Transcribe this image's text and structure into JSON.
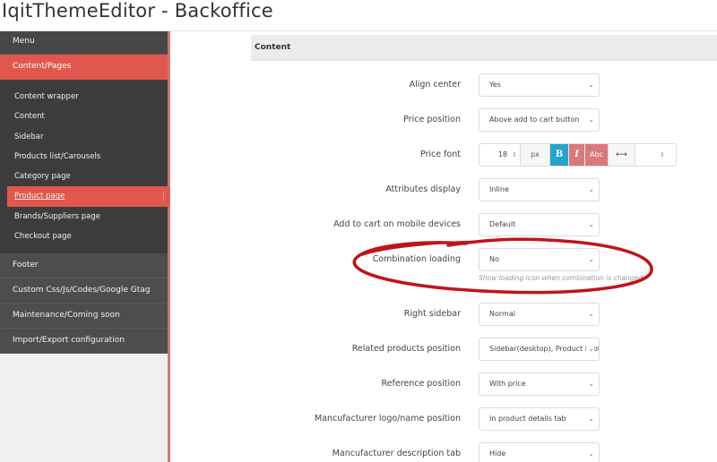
{
  "app": {
    "title": "IqitThemeEditor - Backoffice"
  },
  "sidebar": {
    "menu_label": "Menu",
    "section_active": "Content/Pages",
    "subitems": [
      {
        "label": "Content wrapper"
      },
      {
        "label": "Content"
      },
      {
        "label": "Sidebar"
      },
      {
        "label": "Products list/Carousels"
      },
      {
        "label": "Category page"
      },
      {
        "label": "Product page",
        "active": true
      },
      {
        "label": "Brands/Suppliers page"
      },
      {
        "label": "Checkout page"
      }
    ],
    "sections": [
      {
        "label": "Footer"
      },
      {
        "label": "Custom Css/Js/Codes/Google Gtag"
      },
      {
        "label": "Maintenance/Coming soon"
      },
      {
        "label": "Import/Export configuration"
      }
    ]
  },
  "content": {
    "header": "Content",
    "fields": {
      "align_center": {
        "label": "Align center",
        "value": "Yes"
      },
      "price_position": {
        "label": "Price position",
        "value": "Above add to cart button"
      },
      "price_font": {
        "label": "Price font",
        "size": "18",
        "unit": "px",
        "bold": "B",
        "italic": "I",
        "uppercase": "Abc",
        "spacing_icon": "⟷",
        "spin": "⇕"
      },
      "attributes_display": {
        "label": "Attributes display",
        "value": "Inline"
      },
      "add_to_cart_mobile": {
        "label": "Add to cart on mobile devices",
        "value": "Default"
      },
      "combination_loading": {
        "label": "Combination loading",
        "value": "No",
        "help": "Show loading icon when combination is changed"
      },
      "right_sidebar": {
        "label": "Right sidebar",
        "value": "Normal"
      },
      "related_products_position": {
        "label": "Related products position",
        "value": "Sidebar(desktop), Product Footer"
      },
      "reference_position": {
        "label": "Reference position",
        "value": "With price"
      },
      "manufacturer_logo_position": {
        "label": "Mancufacturer logo/name position",
        "value": "In product details tab"
      },
      "manufacturer_description_tab": {
        "label": "Mancufacturer description tab",
        "value": "Hide"
      }
    },
    "chevron": "⌄"
  },
  "colors": {
    "accent": "#e2574c",
    "sidebar_bg": "#4a4a4a",
    "bold_btn": "#27a3c9",
    "style_btn": "#d9797a",
    "annotation": "#c0141a"
  }
}
